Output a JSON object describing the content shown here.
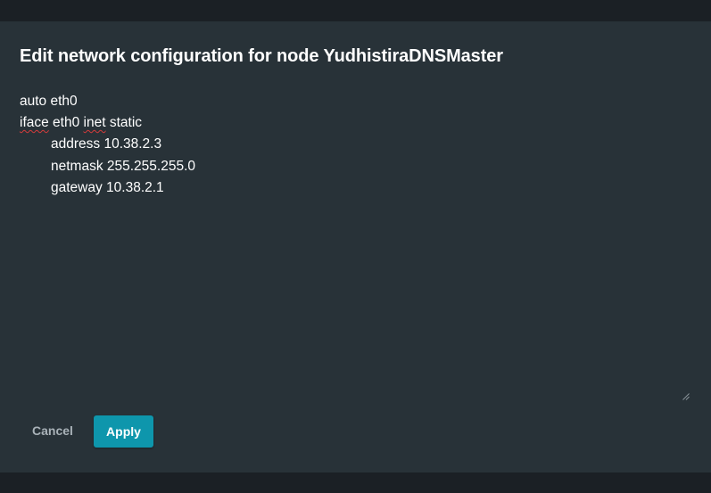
{
  "dialog": {
    "title": "Edit network configuration for node YudhistiraDNSMaster",
    "config_lines": {
      "line1": "auto eth0",
      "line2_word1": "iface",
      "line2_mid": " eth0 ",
      "line2_word2": "inet",
      "line2_end": " static",
      "line3": "address 10.38.2.3",
      "line4": "netmask 255.255.255.0",
      "line5": "gateway 10.38.2.1"
    },
    "cancel_label": "Cancel",
    "apply_label": "Apply"
  },
  "colors": {
    "dialog_bg": "#283238",
    "backdrop": "#1b2025",
    "accent": "#0e96ac",
    "spellcheck": "#d23b3b"
  },
  "icons": {
    "resize": "resize-grip-icon"
  }
}
